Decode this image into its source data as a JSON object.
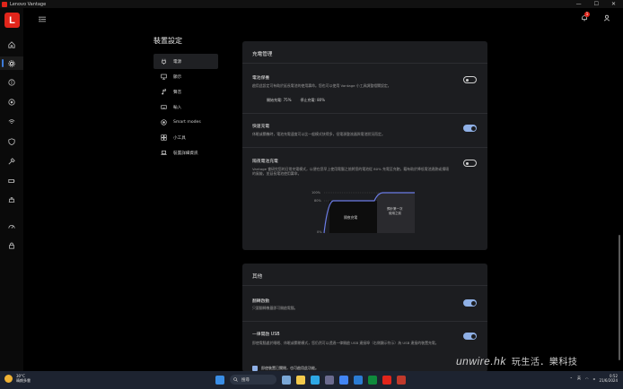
{
  "window": {
    "title": "Lenovo Vantage",
    "min": "—",
    "max": "☐",
    "close": "✕"
  },
  "rail": {
    "logo": "L"
  },
  "header": {
    "notification_count": "1"
  },
  "page": {
    "title": "裝置設定"
  },
  "nav": [
    {
      "label": "電源",
      "icon": "plug-icon",
      "active": true
    },
    {
      "label": "顯示",
      "icon": "monitor-icon"
    },
    {
      "label": "聲音",
      "icon": "music-icon"
    },
    {
      "label": "輸入",
      "icon": "keyboard-icon"
    },
    {
      "label": "Smart modes",
      "icon": "smart-mode-icon"
    },
    {
      "label": "小工具",
      "icon": "widgets-icon"
    },
    {
      "label": "裝置詳細資訊",
      "icon": "laptop-icon"
    }
  ],
  "charging": {
    "title": "充電管理",
    "battery_saver": {
      "title": "電池保養",
      "desc": "啟用此設定可有助於延長電池的使用壽命。您也可以使用 Vantage 小工具調整相關設定。",
      "start_label": "開始充電: 75%",
      "stop_label": "停止充電: 80%",
      "enabled": false
    },
    "rapid": {
      "title": "快速充電",
      "desc": "休眠或關機時，電池充電速度可以比一般模式快得多，但電源整流器與電池狀況而定。",
      "enabled": true
    },
    "overnight": {
      "title": "隔夜電池充電",
      "desc": "Vantage 會研究您的日常充電模式，以便在您早上使用電腦之前將您的電池從 80% 充電至充飽，藉有助於降低電池過熱或損壞的風險，並延長電池使用壽命。",
      "enabled": false,
      "chart": {
        "y_top": "100%",
        "y_mid": "80%",
        "y_bottom": "0%",
        "label_overnight": "隔夜充電",
        "label_before_1": "預計第一次",
        "label_before_2": "使用之前"
      }
    }
  },
  "other": {
    "title": "其他",
    "flip_boot": {
      "title": "翻轉啟動",
      "desc": "只要翻轉機蓋即可開啟電腦。",
      "enabled": true
    },
    "usb_charge": {
      "title": "一律開啟 USB",
      "desc": "即使電腦處於睡眠、休眠或關閉模式，您仍然可以透過一律開啟 USB 連接埠（右側顯示符示）為 USB 連接的裝置充電。",
      "enabled": true,
      "checkbox_label": "即使裝置已關閉，也可啟用此功能。"
    }
  },
  "taskbar": {
    "weather_temp": "30°C",
    "weather_desc": "晴朗多雲",
    "search_placeholder": "搜尋",
    "lang": "英",
    "time": "0:52",
    "date": "21/6/2024"
  },
  "watermark": {
    "brand": "unwire.hk",
    "sub": "玩生活．樂科技"
  }
}
